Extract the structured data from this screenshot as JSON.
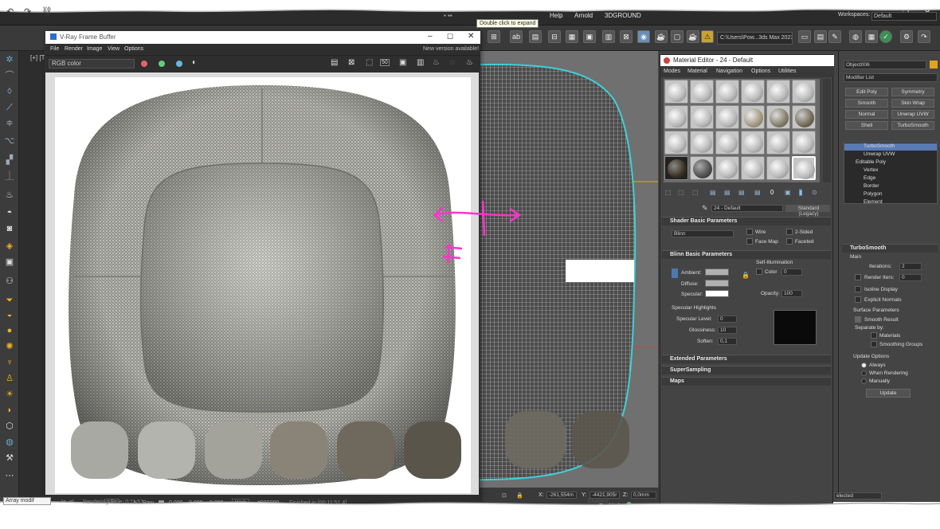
{
  "menu": {
    "items": [
      "Help",
      "Arnold",
      "3DGROUND"
    ],
    "tooltip": "Double click to expand"
  },
  "toolbar": {
    "path": "C:\\Users\\Pow...3ds Max 2023",
    "workspaces_label": "Workspaces:",
    "workspace": "Default"
  },
  "viewport_label": "[+] [T",
  "vfb": {
    "title": "V-Ray Frame Buffer",
    "menu": [
      "File",
      "Render",
      "Image",
      "View",
      "Options"
    ],
    "new_version": "New version available!",
    "channel": "RGB color",
    "footer": {
      "coords": "[0, 0]",
      "zoom": "1x1",
      "raw": "Raw",
      "vals": [
        "0.000",
        "0.000",
        "0.000"
      ],
      "profile": "Web",
      "hex": "#000000",
      "finished": "Finished in [00:11:51.4]"
    }
  },
  "matedit": {
    "title": "Material Editor - 24 - Default",
    "menu": [
      "Modes",
      "Material",
      "Navigation",
      "Options",
      "Utilities"
    ],
    "material_name": "24 - Default",
    "material_type": "Standard (Legacy)",
    "shader_basic": {
      "title": "Shader Basic Parameters",
      "shader": "Blinn",
      "wire": "Wire",
      "two_sided": "2-Sided",
      "face_map": "Face Map",
      "faceted": "Faceted"
    },
    "blinn_basic": {
      "title": "Blinn Basic Parameters",
      "self_illum": "Self-Illumination",
      "ambient": "Ambient:",
      "diffuse": "Diffuse:",
      "specular": "Specular:",
      "color": "Color",
      "color_val": "0",
      "opacity": "Opacity:",
      "opacity_val": "100"
    },
    "spec_hl": {
      "title": "Specular Highlights",
      "level": "Specular Level:",
      "level_val": "0",
      "gloss": "Glossiness:",
      "gloss_val": "10",
      "soften": "Soften:",
      "soften_val": "0,1"
    },
    "rollouts": [
      "Extended Parameters",
      "SuperSampling",
      "Maps"
    ]
  },
  "cmdpanel": {
    "object": "Object006",
    "modlist": "Modifier List",
    "buttons": [
      "Edit Poly",
      "Symmetry",
      "Smooth",
      "Skin Wrap",
      "Normal",
      "Unwrap UVW",
      "Shell",
      "TurboSmooth"
    ],
    "stack": [
      "TurboSmooth",
      "Unwrap UVW",
      "Editable Poly",
      "Vertex",
      "Edge",
      "Border",
      "Polygon",
      "Element"
    ],
    "turbo": {
      "title": "TurboSmooth",
      "main": "Main",
      "iterations": "Iterations:",
      "iter_val": "2",
      "render_iters": "Render Iters:",
      "render_val": "0",
      "isoline": "Isoline Display",
      "explicit": "Explicit Normals",
      "surface": "Surface Parameters",
      "smooth_result": "Smooth Result",
      "separate": "Separate by:",
      "materials": "Materials",
      "smoothing": "Smoothing Groups",
      "update_opts": "Update Options",
      "always": "Always",
      "when_rendering": "When Rendering",
      "manually": "Manually",
      "update": "Update"
    }
  },
  "status": {
    "x_label": "X:",
    "x": "-261,554m",
    "y_label": "Y:",
    "y": "-4421,905r",
    "z_label": "Z:",
    "z": "0,0mm",
    "enabled": "Enabled:",
    "selected": "elected"
  },
  "bottom": {
    "left1": "Array modif",
    "left2": "Rendering Time: 0:11:51"
  }
}
